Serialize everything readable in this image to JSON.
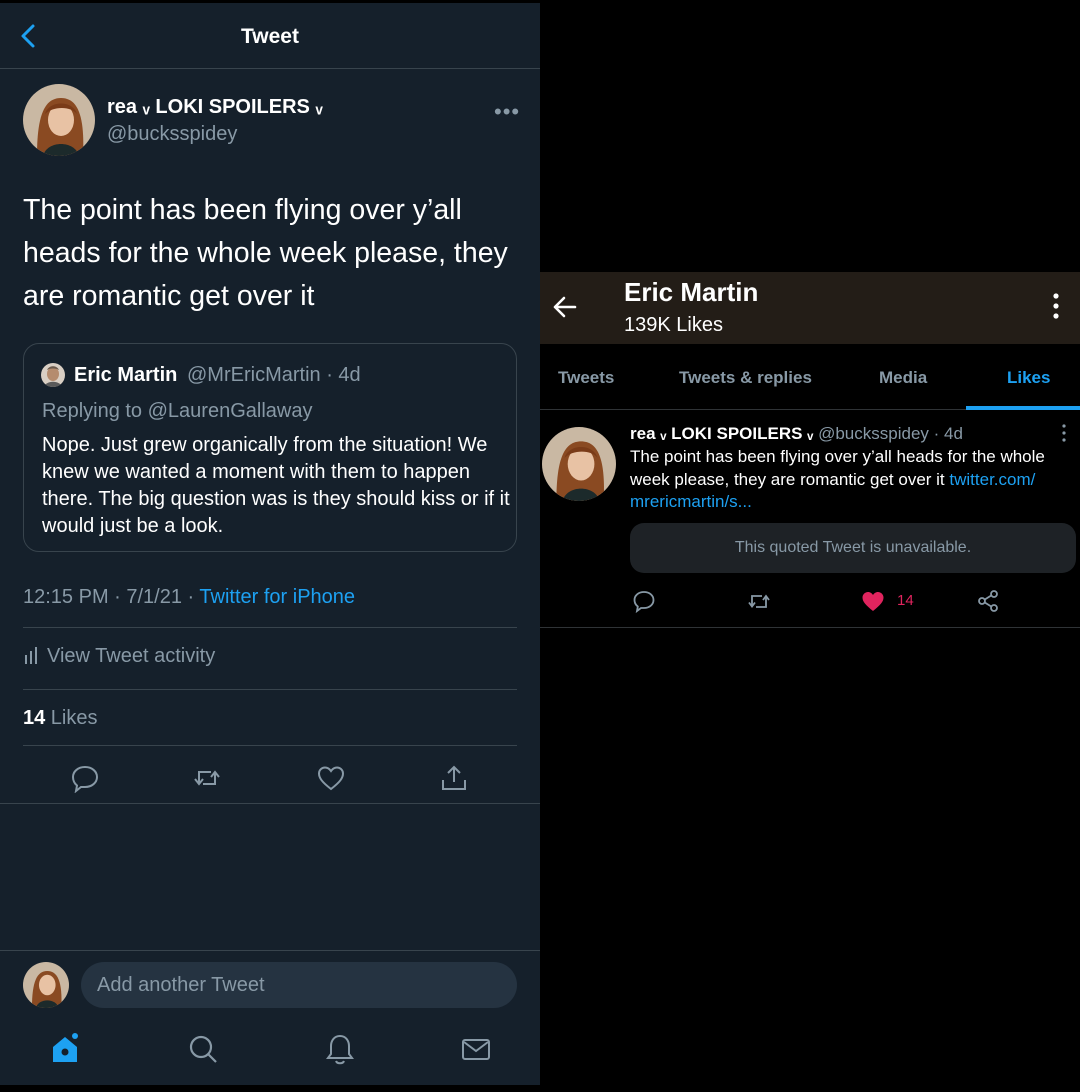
{
  "left_screen": {
    "header": {
      "title": "Tweet"
    },
    "tweet": {
      "author_name": "rea ᵥ LOKI SPOILERS ᵥ",
      "author_handle": "@bucksspidey",
      "text": "The point has been flying over y’all heads for the whole week please, they are romantic get over it",
      "quoted": {
        "name": "Eric Martin",
        "meta": "@MrEricMartin · 4d",
        "replying_to": "Replying to @LaurenGallaway",
        "text": "Nope. Just grew organically from the situation! We knew we wanted a moment with them to happen there. The big question was is they should kiss or if it would just be a look."
      },
      "timestamp": "12:15 PM · 7/1/21 · ",
      "source": "Twitter for iPhone",
      "activity_label": "View Tweet activity",
      "likes_count": "14",
      "likes_label": " Likes"
    },
    "compose_placeholder": "Add another Tweet",
    "colors": {
      "background": "#15202b",
      "accent": "#1da1f2",
      "muted": "#8899a6",
      "border": "#38444d"
    },
    "icons": [
      "back-chevron-icon",
      "more-dots-icon",
      "reply-icon",
      "retweet-icon",
      "like-icon",
      "share-icon",
      "home-icon",
      "search-icon",
      "notifications-icon",
      "messages-icon"
    ]
  },
  "right_screen": {
    "header": {
      "name": "Eric Martin",
      "likes_count": "139K Likes"
    },
    "tabs": [
      "Tweets",
      "Tweets & replies",
      "Media",
      "Likes"
    ],
    "active_tab": "Likes",
    "liked_tweet": {
      "author_name": "rea ᵥ LOKI SPOILERS ᵥ",
      "meta": "@bucksspidey · 4d",
      "text": "The point has been flying over y’all heads for the whole week please, they are romantic get over it ",
      "link": "twitter.com/ mrericmartin/s...",
      "quoted_unavailable": "This quoted Tweet is unavailable.",
      "like_count": "14"
    },
    "colors": {
      "background": "#000000",
      "header": "#231d17",
      "accent": "#1da1f2",
      "like": "#e0245e"
    },
    "icons": [
      "back-arrow-icon",
      "kebab-icon",
      "reply-icon",
      "retweet-icon",
      "heart-filled-icon",
      "share-icon"
    ]
  }
}
